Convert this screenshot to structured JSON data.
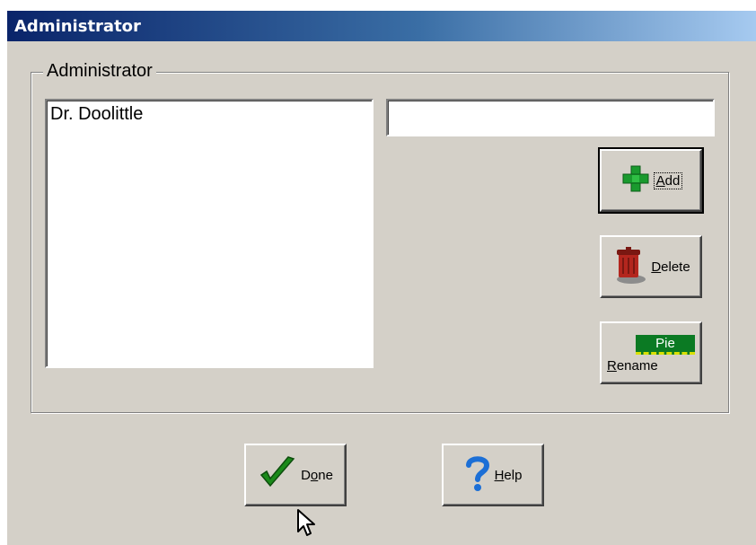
{
  "window": {
    "title": "Administrator"
  },
  "group": {
    "label": "Administrator"
  },
  "list": {
    "items": [
      "Dr. Doolittle"
    ]
  },
  "name_field": {
    "value": ""
  },
  "buttons": {
    "add": {
      "accel": "A",
      "rest": "dd",
      "icon": "plus-icon"
    },
    "delete": {
      "accel": "D",
      "rest": "elete",
      "icon": "trash-can-icon"
    },
    "rename": {
      "top_text": "Pie",
      "accel": "R",
      "rest": "ename",
      "icon": "rename-label-icon"
    },
    "done": {
      "pre": "D",
      "accel": "o",
      "rest": "ne",
      "icon": "checkmark-icon"
    },
    "help": {
      "accel": "H",
      "rest": "elp",
      "icon": "question-mark-icon"
    }
  },
  "colors": {
    "title_start": "#0a246a",
    "title_end": "#a6caf0",
    "face": "#d4d0c8",
    "plus_green": "#1a9a2e",
    "check_green": "#1a8a1a",
    "help_blue": "#1c6fd6",
    "trash_red": "#b3261e"
  }
}
